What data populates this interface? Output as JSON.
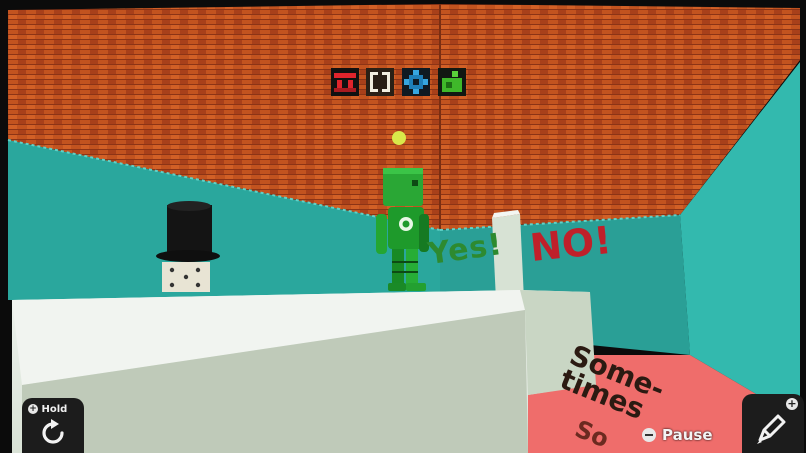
{
  "scene": {
    "wall_writing": {
      "yes": "Yes!",
      "no": "NO!",
      "floor_line1": "Some-",
      "floor_line2": "times",
      "floor_line3": "So"
    },
    "collectibles": [
      "red-block-icon",
      "white-bracket-icon",
      "blue-gear-icon",
      "green-block-icon"
    ],
    "colors": {
      "brick": "#c4521e",
      "wall_teal": "#2db3a8",
      "floor_white": "#e8efe8",
      "floor_pink": "#f07070",
      "robot_green": "#1f9a2e"
    }
  },
  "hud": {
    "hold_label": "Hold",
    "pause_label": "Pause",
    "edit_plus": "+"
  }
}
